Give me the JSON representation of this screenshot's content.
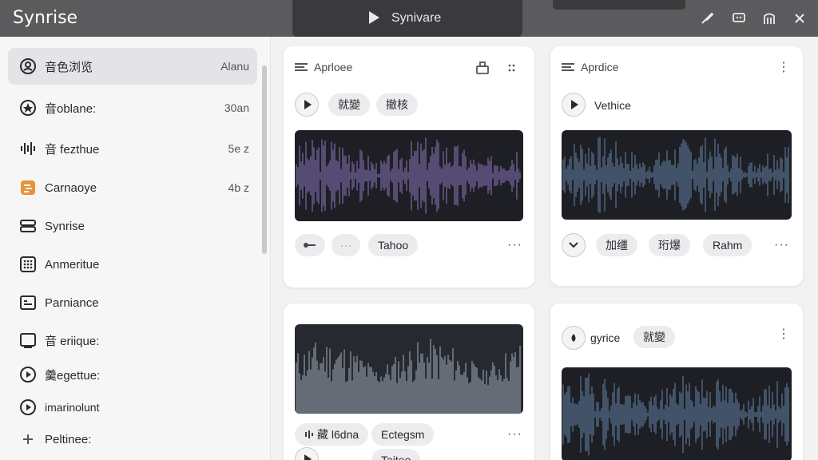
{
  "app": {
    "title": "Synrise"
  },
  "titlebar": {
    "now_playing": "Synivare"
  },
  "colors": {
    "titlebar": "#5b5b5e",
    "wave_purple": "#7d6aa8",
    "wave_blue": "#5a7696",
    "wave_gray": "#9aa0a8"
  },
  "sidebar": {
    "items": [
      {
        "label": "音色浏览",
        "meta": "Alanu",
        "icon": "user-circle-icon"
      },
      {
        "label": "音oblane:",
        "meta": "30an",
        "icon": "star-circle-icon"
      },
      {
        "label": "音 fezthue",
        "meta": "5e z",
        "icon": "waveform-icon"
      },
      {
        "label": "Carnaoye",
        "meta": "4b z",
        "icon": "orange-app-icon"
      },
      {
        "label": "Synrise",
        "meta": "",
        "icon": "stack-icon"
      },
      {
        "label": "Anmeritue",
        "meta": "",
        "icon": "grid-icon"
      },
      {
        "label": "Parniance",
        "meta": "",
        "icon": "document-icon"
      },
      {
        "label": "音 eriique:",
        "meta": "",
        "icon": "monitor-icon"
      },
      {
        "label": "羹egettue:",
        "meta": "",
        "icon": "play-circle-icon"
      },
      {
        "label": "imarinolunt",
        "meta": "",
        "icon": "play-circle-icon"
      },
      {
        "label": "Peltinee:",
        "meta": "",
        "icon": "plus-icon"
      }
    ]
  },
  "cards": {
    "c1": {
      "title": "Aprloee",
      "tag1": "就變",
      "tag2": "撤核",
      "footer_tag": "Tahoo"
    },
    "c2": {
      "title": "Aprdice",
      "subtitle": "Vethice",
      "tag1": "加缰",
      "tag2": "珩爆",
      "tag3": "Rahm"
    },
    "c3": {
      "tag1": "藏 l6dna",
      "tag2": "Ectegsm",
      "bottom_tag": "Taiteo"
    },
    "c4": {
      "subtitle": "gyrice",
      "tag1": "就變"
    }
  }
}
